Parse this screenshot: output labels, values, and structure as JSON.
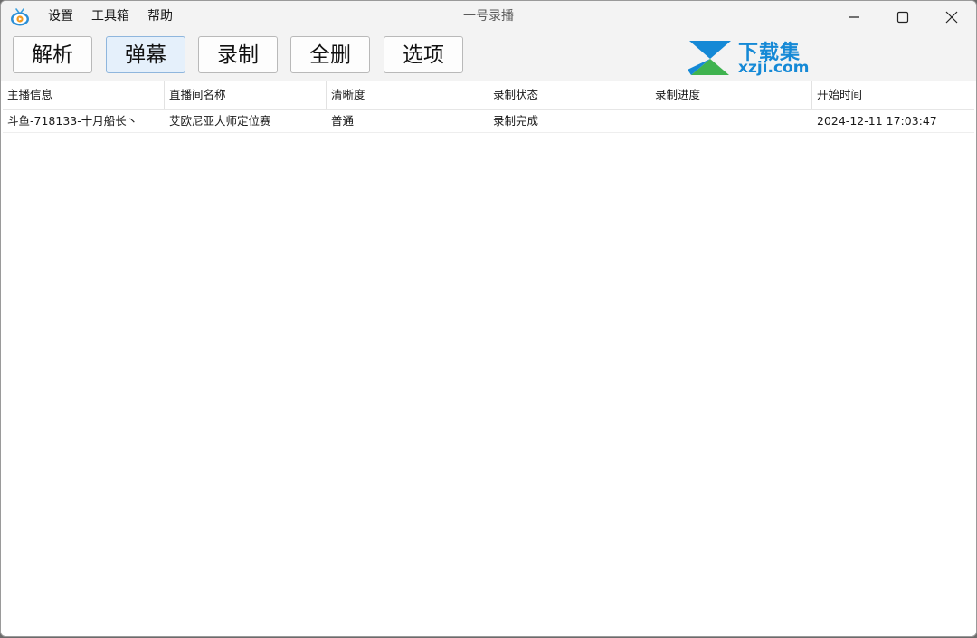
{
  "app": {
    "title": "一号录播",
    "icon": "tv-logo-icon"
  },
  "menu": {
    "items": [
      {
        "label": "设置"
      },
      {
        "label": "工具箱"
      },
      {
        "label": "帮助"
      }
    ]
  },
  "window_controls": {
    "minimize_icon": "minimize-icon",
    "maximize_icon": "maximize-icon",
    "close_icon": "close-icon"
  },
  "toolbar": {
    "buttons": [
      {
        "label": "解析",
        "active": false
      },
      {
        "label": "弹幕",
        "active": true
      },
      {
        "label": "录制",
        "active": false
      },
      {
        "label": "全删",
        "active": false
      },
      {
        "label": "选项",
        "active": false
      }
    ]
  },
  "watermark": {
    "line1": "下载集",
    "line2": "xzji.com"
  },
  "table": {
    "columns": [
      "主播信息",
      "直播间名称",
      "清晰度",
      "录制状态",
      "录制进度",
      "开始时间"
    ],
    "rows": [
      [
        "斗鱼-718133-十月船长丶",
        "艾欧尼亚大师定位赛",
        "普通",
        "录制完成",
        "",
        "2024-12-11 17:03:47"
      ]
    ]
  },
  "colors": {
    "accent": "#1589d6",
    "active_button_bg": "#e5f0fb"
  }
}
